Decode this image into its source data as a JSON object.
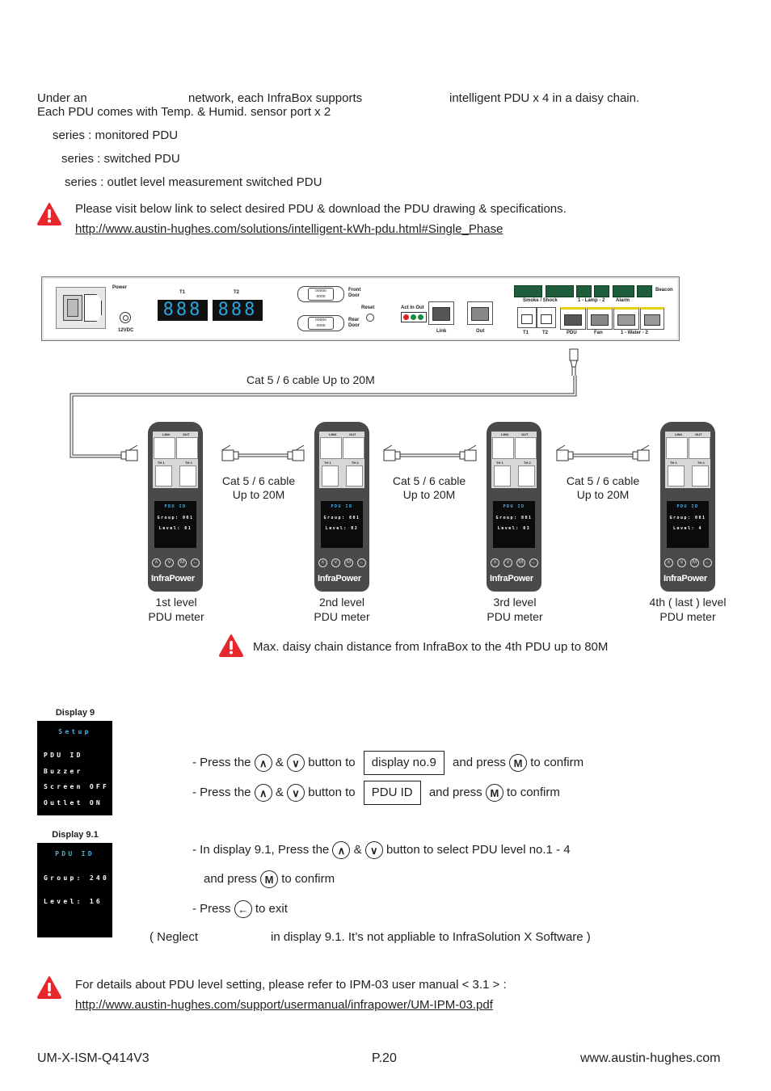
{
  "intro": {
    "line1_a": "Under an",
    "line1_b": "network, each InfraBox supports",
    "line1_c": "intelligent PDU x 4 in a daisy chain.",
    "line2": "Each PDU comes with Temp. & Humid. sensor port x 2",
    "series": [
      "series : monitored PDU",
      "series : switched PDU",
      "series : outlet level measurement switched PDU"
    ]
  },
  "notice1": {
    "icon": "warning-icon",
    "text": "Please visit below link to select desired PDU & download the PDU drawing & specifications.",
    "link": "http://www.austin-hughes.com/solutions/intelligent-kWh-pdu.html#Single_Phase"
  },
  "infrabox_panel": {
    "power_label": "Power",
    "dc_label": "12VDC",
    "t1_label": "T1",
    "t2_label": "T2",
    "t1_display": "888",
    "t2_display": "888",
    "front_door": "Front Door",
    "rear_door": "Rear Door",
    "reset": "Reset",
    "act_in_out": "Act In Out",
    "link": "Link",
    "out": "Out",
    "smoke_shock": "Smoke  /  Shock",
    "lamp": "1 - Lamp - 2",
    "alarm": "Alarm",
    "beacon": "Beacon",
    "bottom_ports": [
      "T1",
      "T2",
      "PDU",
      "Fan",
      "1 - Water - 2"
    ],
    "led_colors": [
      "#e31e24",
      "#1a8a3c",
      "#1a8a3c"
    ]
  },
  "diagram": {
    "top_cable_label": "Cat 5 / 6 cable Up to 20M",
    "cable_label_line1": "Cat 5 / 6 cable",
    "cable_label_line2": "Up to 20M",
    "pdus": [
      {
        "link": "LINK",
        "out": "OUT",
        "th1": "TH 1",
        "th2": "TH 2",
        "screen_title": "PDU  ID",
        "group": "Group:  001",
        "level": "Level:  01",
        "brand": "InfraPower",
        "caption1": "1st level",
        "caption2": "PDU meter"
      },
      {
        "link": "LINK",
        "out": "OUT",
        "th1": "TH 1",
        "th2": "TH 2",
        "screen_title": "PDU  ID",
        "group": "Group:  001",
        "level": "Level:  02",
        "brand": "InfraPower",
        "caption1": "2nd level",
        "caption2": "PDU meter"
      },
      {
        "link": "LINK",
        "out": "OUT",
        "th1": "TH 1",
        "th2": "TH 2",
        "screen_title": "PDU  ID",
        "group": "Group:  001",
        "level": "Level:  03",
        "brand": "InfraPower",
        "caption1": "3rd level",
        "caption2": "PDU meter"
      },
      {
        "link": "LINK",
        "out": "OUT",
        "th1": "TH 1",
        "th2": "TH 2",
        "screen_title": "PDU  ID",
        "group": "Group:  001",
        "level": "Level:  4",
        "brand": "InfraPower",
        "caption1": "4th ( last ) level",
        "caption2": "PDU meter"
      }
    ],
    "max_distance_note": "Max. daisy chain distance from InfraBox to the 4th PDU up to 80M"
  },
  "display9": {
    "label": "Display 9",
    "title": "Setup",
    "lines": [
      "PDU  ID",
      "Buzzer",
      "Screen  OFF",
      "Outlet  ON"
    ]
  },
  "display91": {
    "label": "Display 9.1",
    "title": "PDU  ID",
    "group": "Group:  240",
    "level": "Level:  16"
  },
  "steps": {
    "s1": {
      "a": "-  Press the",
      "amp": "&",
      "b": "button to",
      "box": "display no.9",
      "c": "and press",
      "d": "to confirm"
    },
    "s2": {
      "a": "-  Press the",
      "amp": "&",
      "b": "button to",
      "box": "PDU  ID",
      "c": "and press",
      "d": "to confirm"
    },
    "s3": {
      "a": "-  In display 9.1, Press the",
      "amp": "&",
      "b": "button to select PDU level no.1 - 4"
    },
    "s4": {
      "a": "and press",
      "b": "to confirm"
    },
    "s5": {
      "a": "-  Press",
      "b": "to exit"
    },
    "note_a": "( Neglect",
    "note_b": "in display 9.1.  It’s not appliable to InfraSolution X Software )",
    "icons": {
      "up": "∧",
      "down": "∨",
      "menu": "M",
      "back": "←"
    }
  },
  "notice2": {
    "icon": "warning-icon",
    "text": "For details about PDU level setting, please refer to IPM-03 user manual < 3.1 > :",
    "link": "http://www.austin-hughes.com/support/usermanual/infrapower/UM-IPM-03.pdf"
  },
  "footer": {
    "doc_id": "UM-X-ISM-Q414V3",
    "page": "P.20",
    "website": "www.austin-hughes.com"
  }
}
